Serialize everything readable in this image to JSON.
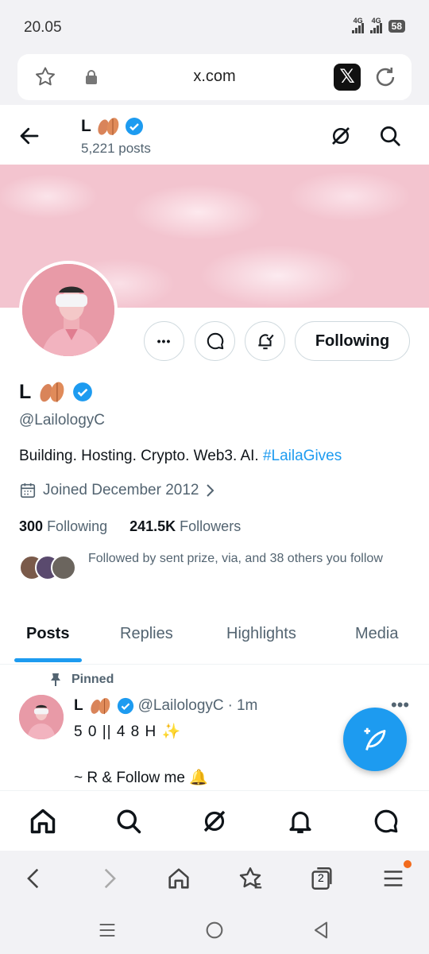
{
  "status": {
    "time": "20.05",
    "net1": "4G",
    "net2": "4G",
    "battery": "58"
  },
  "browser": {
    "url": "x.com",
    "x_button": "𝕏",
    "tab_count": "2"
  },
  "header": {
    "name": "L",
    "posts": "5,221 posts"
  },
  "profile": {
    "name": "L",
    "handle": "@LailologyC",
    "bio_text": "Building. Hosting. Crypto. Web3. AI. ",
    "bio_tag": "#LailaGives",
    "joined": "Joined December 2012",
    "following_count": "300",
    "following_label": "Following",
    "followers_count": "241.5K",
    "followers_label": "Followers",
    "followed_by": "Followed by sent prize, via, and 38 others you follow",
    "follow_button": "Following",
    "more_button": "•••"
  },
  "tabs": [
    "Posts",
    "Replies",
    "Highlights",
    "Media"
  ],
  "pinned_post": {
    "pinned_label": "Pinned",
    "name": "L",
    "handle": "@LailologyC",
    "sep": "·",
    "time": "1m",
    "more": "•••",
    "line1": "5 0 || 4 8 H ✨",
    "line2": "~ R & Follow me 🔔"
  },
  "colors": {
    "accent": "#1d9bf0",
    "text": "#0f1419",
    "muted": "#536471"
  }
}
